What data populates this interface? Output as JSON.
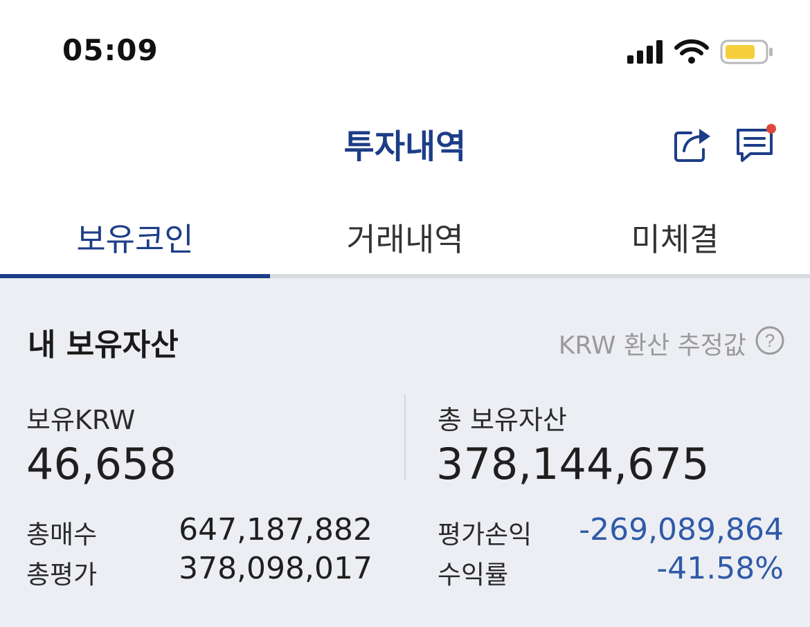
{
  "status_bar": {
    "time": "05:09",
    "signal_icon": "cellular-signal-icon",
    "wifi_icon": "wifi-icon",
    "battery_icon": "battery-icon",
    "battery_color": "#f5cf3b"
  },
  "header": {
    "title": "투자내역",
    "share_icon": "share-icon",
    "chat_icon": "chat-icon",
    "notification_dot_color": "#e0463a"
  },
  "tabs": [
    {
      "label": "보유코인",
      "active": true
    },
    {
      "label": "거래내역",
      "active": false
    },
    {
      "label": "미체결",
      "active": false
    }
  ],
  "assets": {
    "title": "내 보유자산",
    "note": "KRW 환산 추정값",
    "krw_label": "보유KRW",
    "krw_value": "46,658",
    "total_label": "총 보유자산",
    "total_value": "378,144,675",
    "rows_left": [
      {
        "label": "총매수",
        "value": "647,187,882"
      },
      {
        "label": "총평가",
        "value": "378,098,017"
      }
    ],
    "rows_right": [
      {
        "label": "평가손익",
        "value": "-269,089,864"
      },
      {
        "label": "수익률",
        "value": "-41.58%"
      }
    ]
  },
  "colors": {
    "brand": "#1d3d87",
    "negative": "#2f5aa8",
    "panel_bg": "#eceef3"
  }
}
